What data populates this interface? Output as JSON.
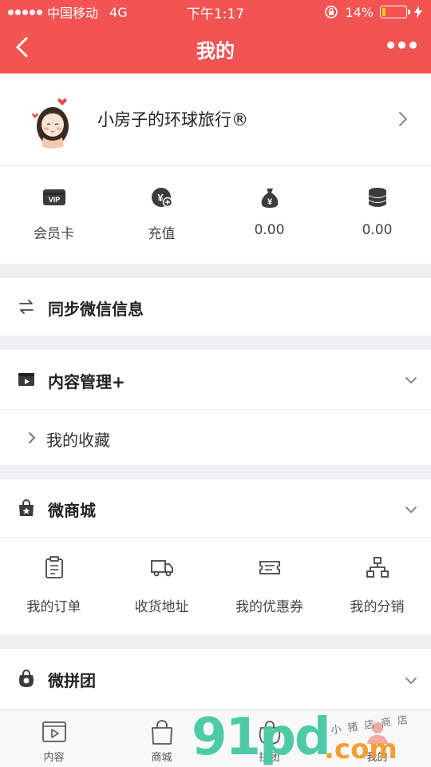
{
  "status_bar": {
    "carrier": "中国移动",
    "network": "4G",
    "time": "下午1:17",
    "battery": "14%",
    "battery_level": 0.14
  },
  "nav": {
    "title": "我的"
  },
  "profile": {
    "name": "小房子的环球旅行®"
  },
  "stats": [
    {
      "icon": "vip-card-icon",
      "label": "会员卡"
    },
    {
      "icon": "recharge-coin-icon",
      "label": "充值"
    },
    {
      "icon": "money-bag-icon",
      "label": "0.00"
    },
    {
      "icon": "coins-stack-icon",
      "label": "0.00"
    }
  ],
  "sync": {
    "title": "同步微信信息"
  },
  "content": {
    "title": "内容管理+",
    "favorites": "我的收藏"
  },
  "shop": {
    "title": "微商城",
    "items": [
      {
        "icon": "order-clipboard-icon",
        "label": "我的订单"
      },
      {
        "icon": "delivery-truck-icon",
        "label": "收货地址"
      },
      {
        "icon": "coupon-icon",
        "label": "我的优惠券"
      },
      {
        "icon": "org-chart-icon",
        "label": "我的分销"
      }
    ]
  },
  "group": {
    "title": "微拼团"
  },
  "tabs": [
    {
      "icon": "video-play-icon",
      "label": "内容"
    },
    {
      "icon": "shopping-bag-icon",
      "label": "商城"
    },
    {
      "icon": "group-bag-icon",
      "label": "拼团"
    },
    {
      "icon": "user-icon",
      "label": "我的"
    }
  ],
  "watermark": {
    "big": "91pd",
    "com": ".com",
    "cn": "小猪店商店"
  },
  "colors": {
    "brand": "#f25353",
    "background": "#efeef3"
  }
}
